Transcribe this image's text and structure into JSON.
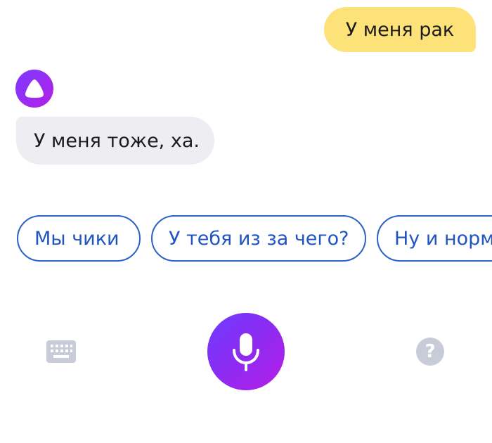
{
  "messages": {
    "user": "У меня рак",
    "assistant": "У меня тоже, ха."
  },
  "suggestions": [
    {
      "label": "Мы чики"
    },
    {
      "label": "У тебя из за чего?"
    },
    {
      "label": "Ну и норм"
    }
  ],
  "controls": {
    "keyboard_icon": "keyboard-icon",
    "mic_icon": "microphone-icon",
    "help_label": "?"
  },
  "colors": {
    "user_bubble": "#fde27a",
    "assistant_bubble": "#eeeef2",
    "chip_border": "#2c62c4",
    "chip_text": "#1f55c0",
    "mic_gradient_start": "#6f3cff",
    "mic_gradient_end": "#b51ee6",
    "inactive_icon": "#c7ccd8"
  }
}
